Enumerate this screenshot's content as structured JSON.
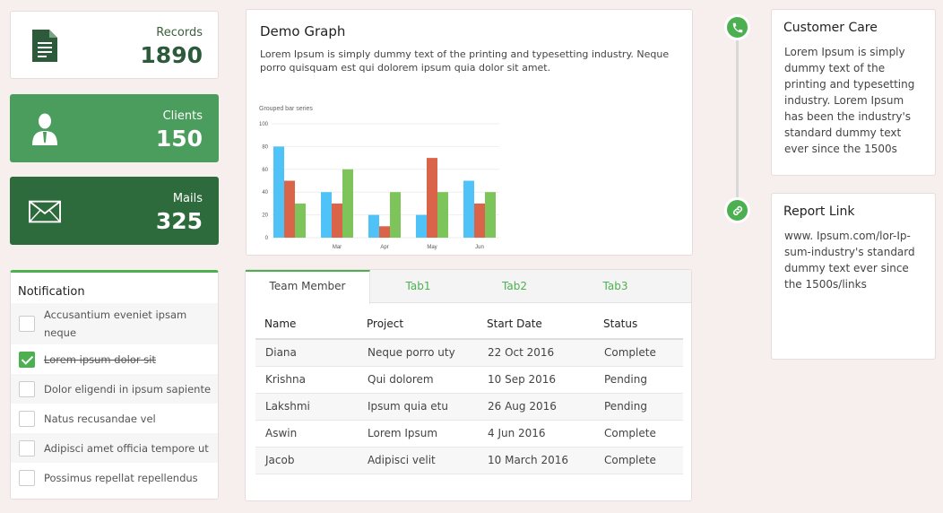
{
  "stats": {
    "records": {
      "label": "Records",
      "value": "1890",
      "icon": "document-icon"
    },
    "clients": {
      "label": "Clients",
      "value": "150",
      "icon": "user-icon"
    },
    "mails": {
      "label": "Mails",
      "value": "325",
      "icon": "mail-icon"
    }
  },
  "notification": {
    "title": "Notification",
    "items": [
      {
        "text": "Accusantium eveniet ipsam neque",
        "checked": false
      },
      {
        "text": "Lorem ipsum dolor sit",
        "checked": true
      },
      {
        "text": "Dolor eligendi in ipsum sapiente",
        "checked": false
      },
      {
        "text": "Natus recusandae vel",
        "checked": false
      },
      {
        "text": "Adipisci amet officia tempore ut",
        "checked": false
      },
      {
        "text": "Possimus repellat repellendus",
        "checked": false
      }
    ]
  },
  "graph": {
    "title": "Demo Graph",
    "description": "Lorem Ipsum is simply dummy text of the printing and typesetting industry. Neque porro quisquam est qui dolorem ipsum quia dolor sit amet."
  },
  "chart_data": {
    "type": "bar",
    "title": "Grouped bar series",
    "categories": [
      "",
      "Mar",
      "Apr",
      "May",
      "Jun"
    ],
    "series": [
      {
        "values": [
          80,
          40,
          20,
          20,
          50
        ]
      },
      {
        "values": [
          50,
          30,
          10,
          70,
          30
        ]
      },
      {
        "values": [
          30,
          60,
          40,
          40,
          40
        ]
      }
    ],
    "colors": [
      "#4fc3f7",
      "#d9644a",
      "#7dc55a"
    ],
    "ylim": [
      0,
      100
    ],
    "yticks": [
      0,
      20,
      40,
      60,
      80,
      100
    ],
    "grid": true
  },
  "table": {
    "tabs": [
      "Team Member",
      "Tab1",
      "Tab2",
      "Tab3"
    ],
    "columns": [
      "Name",
      "Project",
      "Start Date",
      "Status"
    ],
    "rows": [
      [
        "Diana",
        "Neque porro uty",
        "22 Oct 2016",
        "Complete"
      ],
      [
        "Krishna",
        "Qui dolorem",
        "10 Sep 2016",
        "Pending"
      ],
      [
        "Lakshmi",
        "Ipsum quia etu",
        "26 Aug 2016",
        "Pending"
      ],
      [
        "Aswin",
        "Lorem Ipsum",
        "4 Jun 2016",
        "Complete"
      ],
      [
        "Jacob",
        "Adipisci velit",
        "10 March 2016",
        "Complete"
      ]
    ]
  },
  "side": {
    "care": {
      "title": "Customer Care",
      "text": "Lorem Ipsum is simply dummy text of the printing and typesetting industry. Lorem Ipsum has been the industry's standard dummy text ever since the 1500s",
      "icon": "phone-icon"
    },
    "report": {
      "title": "Report Link",
      "text": "www. Ipsum.com/lor-Ip-sum-industry's standard dummy text ever since the 1500s/links",
      "icon": "link-icon"
    }
  },
  "colors": {
    "accent": "#4caf50",
    "clients": "#4a9d5c",
    "mails": "#2d6a3c"
  }
}
